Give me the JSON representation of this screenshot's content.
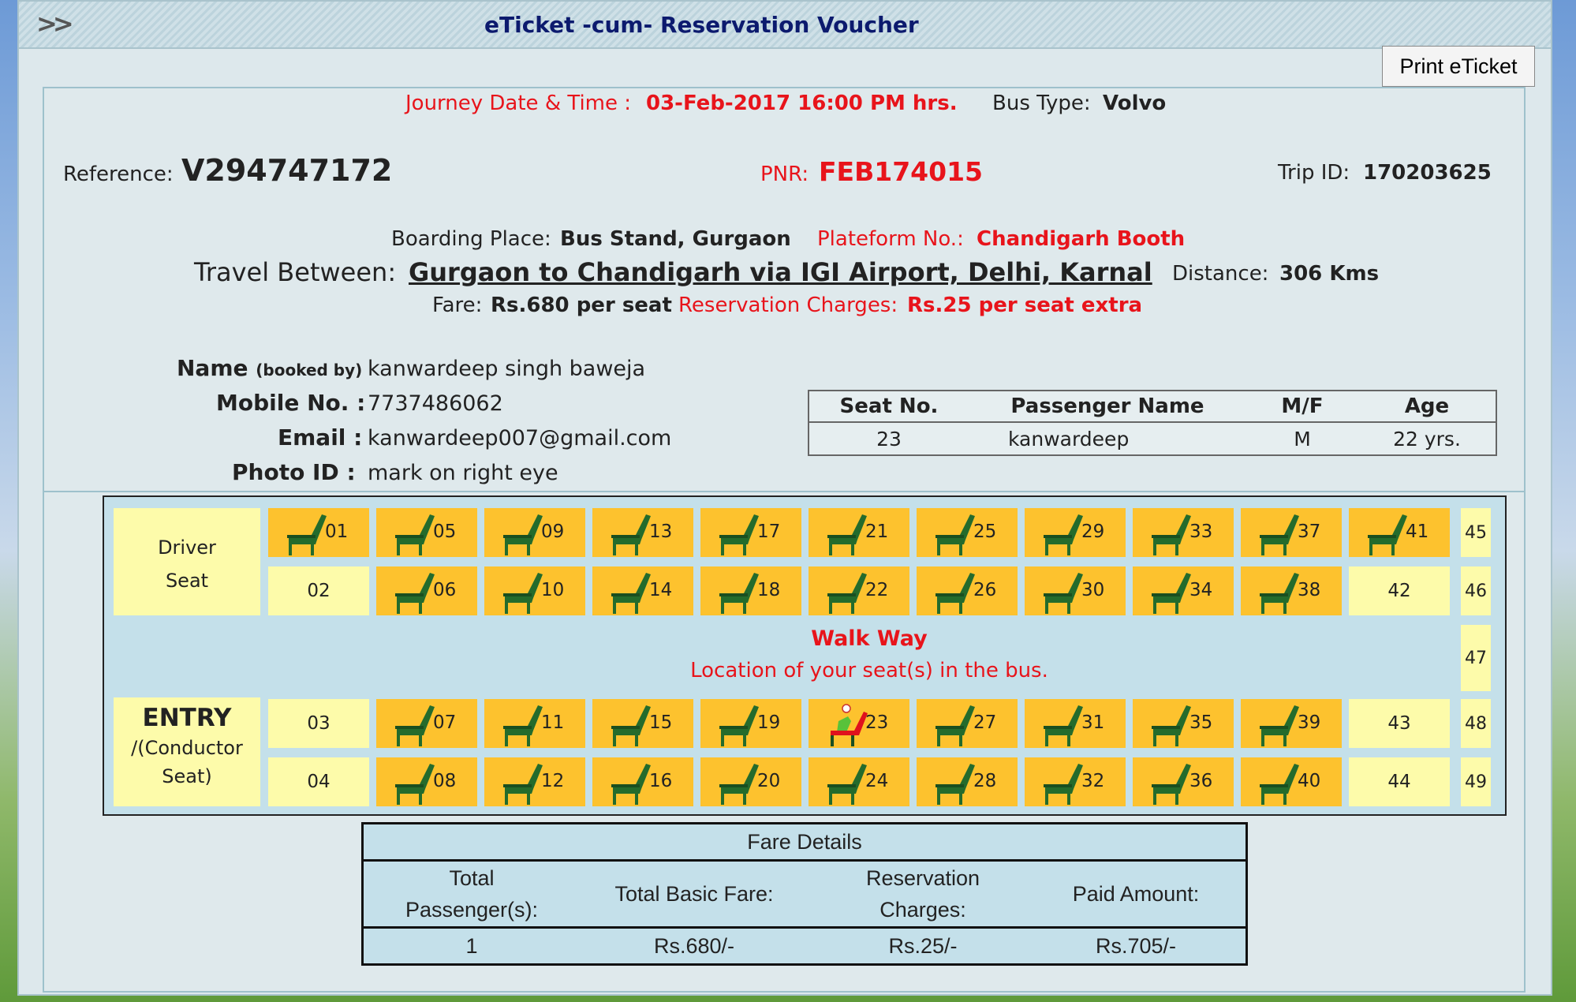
{
  "window": {
    "title": "eTicket -cum- Reservation Voucher",
    "print_label": "Print eTicket"
  },
  "journey": {
    "date_label": "Journey Date & Time :",
    "date_value": "03-Feb-2017 16:00 PM hrs.",
    "bus_type_label": "Bus Type:",
    "bus_type_value": "Volvo",
    "reference_label": "Reference:",
    "reference_value": "V294747172",
    "pnr_label": "PNR:",
    "pnr_value": "FEB174015",
    "trip_label": "Trip ID:",
    "trip_value": "170203625",
    "boarding_label": "Boarding Place:",
    "boarding_value": "Bus Stand, Gurgaon",
    "platform_label": "Plateform No.:",
    "platform_value": "Chandigarh Booth",
    "travel_label": "Travel Between:",
    "travel_value": "Gurgaon to Chandigarh via IGI Airport, Delhi, Karnal",
    "distance_label": "Distance:",
    "distance_value": "306 Kms",
    "fare_label": "Fare:",
    "fare_value": "Rs.680 per seat",
    "res_label": "Reservation Charges:",
    "res_value": "Rs.25 per seat extra"
  },
  "passenger_info": {
    "name_label": "Name",
    "name_suffix": "(booked by)",
    "name_value": "kanwardeep singh baweja",
    "mobile_label": "Mobile No. :",
    "mobile_value": "7737486062",
    "email_label": "Email :",
    "email_value": "kanwardeep007@gmail.com",
    "photo_label": "Photo ID :",
    "photo_value": "mark on right eye"
  },
  "seat_table": {
    "headers": [
      "Seat No.",
      "Passenger Name",
      "M/F",
      "Age"
    ],
    "rows": [
      {
        "seat": "23",
        "name": "kanwardeep",
        "gender": "M",
        "age": "22 yrs."
      }
    ]
  },
  "bus_layout": {
    "driver_line1": "Driver",
    "driver_line2": "Seat",
    "entry_title": "ENTRY",
    "entry_line2": "/(Conductor",
    "entry_line3": "Seat)",
    "walkway": "Walk Way",
    "walkway_sub": "Location of your seat(s) in the bus.",
    "rows": [
      [
        "01",
        "05",
        "09",
        "13",
        "17",
        "21",
        "25",
        "29",
        "33",
        "37",
        "41"
      ],
      [
        "02",
        "06",
        "10",
        "14",
        "18",
        "22",
        "26",
        "30",
        "34",
        "38",
        "42"
      ],
      [
        "03",
        "07",
        "11",
        "15",
        "19",
        "23",
        "27",
        "31",
        "35",
        "39",
        "43"
      ],
      [
        "04",
        "08",
        "12",
        "16",
        "20",
        "24",
        "28",
        "32",
        "36",
        "40",
        "44"
      ]
    ],
    "available": [
      "02",
      "03",
      "04",
      "42",
      "43",
      "44"
    ],
    "mine": [
      "23"
    ],
    "side_seats": [
      "45",
      "46",
      "47",
      "48",
      "49"
    ]
  },
  "fare_details": {
    "title": "Fare Details",
    "h1": "Total",
    "h1b": "Passenger(s):",
    "h2": "Total Basic Fare:",
    "h3": "Reservation",
    "h3b": "Charges:",
    "h4": "Paid Amount:",
    "v1": "1",
    "v2": "Rs.680/-",
    "v3": "Rs.25/-",
    "v4": "Rs.705/-"
  }
}
